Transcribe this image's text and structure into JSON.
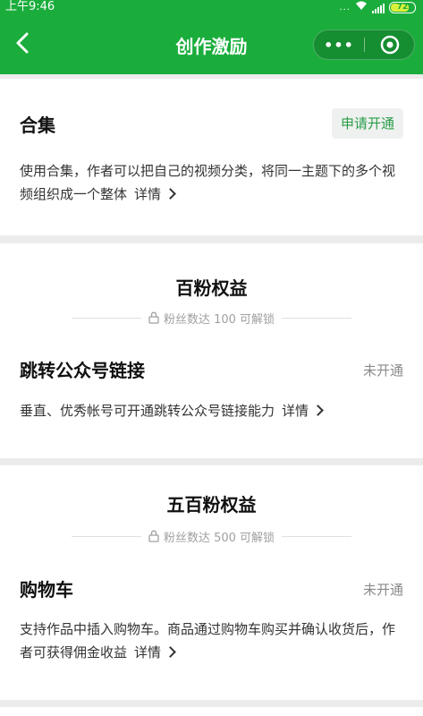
{
  "status_bar": {
    "time": "上午9:46",
    "dots": "...",
    "battery": "72"
  },
  "nav": {
    "back_icon": "chevron-left-icon",
    "title": "创作激励",
    "more_icon": "more-dots-icon",
    "more_label": "•••",
    "close_icon": "record-circle-icon"
  },
  "collection": {
    "title": "合集",
    "button": "申请开通",
    "description": "使用合集，作者可以把自己的视频分类，将同一主题下的多个视频组织成一个整体",
    "detail": "详情"
  },
  "tier_100": {
    "title": "百粉权益",
    "unlock": "粉丝数达 100 可解锁",
    "feature": {
      "title": "跳转公众号链接",
      "status": "未开通",
      "description": "垂直、优秀帐号可开通跳转公众号链接能力",
      "detail": "详情"
    }
  },
  "tier_500": {
    "title": "五百粉权益",
    "unlock": "粉丝数达 500 可解锁",
    "feature": {
      "title": "购物车",
      "status": "未开通",
      "description": "支持作品中插入购物车。商品通过购物车购买并确认收货后，作者可获得佣金收益",
      "detail": "详情"
    }
  },
  "colors": {
    "header_green": "#1aad3c",
    "apply_text": "#2a9d4a",
    "page_bg": "#ececec"
  }
}
